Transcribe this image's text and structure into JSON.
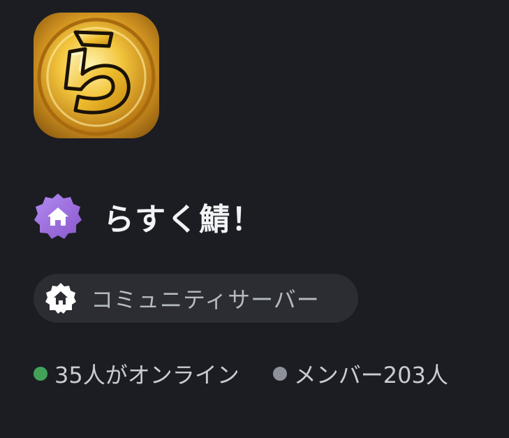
{
  "server": {
    "icon_glyph": "ら",
    "icon_name": "server-icon-coin",
    "name": "らすく鯖！",
    "verified_badge_icon": "home-icon",
    "badge_color": "#9b6fd9"
  },
  "community": {
    "label": "コミュニティサーバー",
    "icon": "home-icon"
  },
  "stats": {
    "online_text": "35人がオンライン",
    "online_color": "#43a25a",
    "members_text": "メンバー203人",
    "members_color": "#8e9199"
  }
}
